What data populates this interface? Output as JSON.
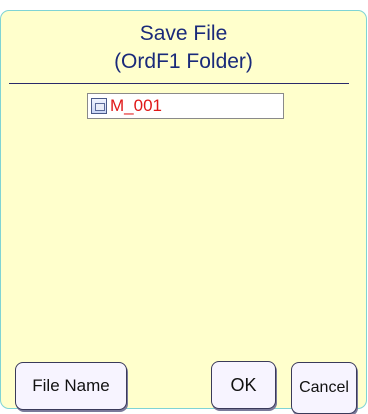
{
  "dialog": {
    "title_line1": "Save File",
    "title_line2": "(OrdF1 Folder)"
  },
  "file_list": {
    "items": [
      {
        "icon": "file-icon",
        "name": "M_001"
      }
    ]
  },
  "buttons": {
    "file_name_label": "File Name",
    "ok_label": "OK",
    "cancel_label": "Cancel"
  },
  "colors": {
    "dialog_background": "#ffffcc",
    "dialog_border": "#7fd4d4",
    "title_text": "#1a2a7a",
    "file_name_text": "#e01818"
  }
}
